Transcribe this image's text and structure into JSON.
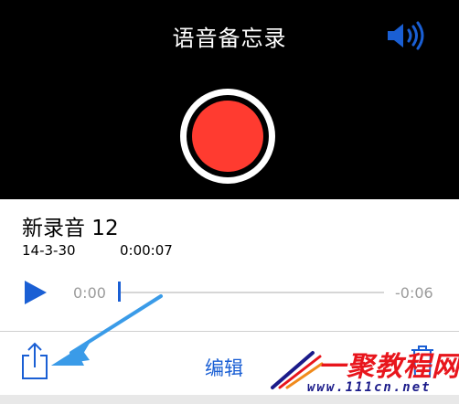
{
  "header": {
    "title": "语音备忘录",
    "speaker_icon": "speaker-volume-icon"
  },
  "record_button": {
    "icon": "record-icon",
    "color": "#ff3b30"
  },
  "recording": {
    "name": "新录音 12",
    "date": "14-3-30",
    "duration": "0:00:07"
  },
  "player": {
    "play_icon": "play-icon",
    "elapsed": "0:00",
    "remaining": "-0:06",
    "progress": 0
  },
  "toolbar": {
    "share_icon": "share-icon",
    "edit_label": "编辑",
    "trash_icon": "trash-icon"
  },
  "watermark": {
    "text": "一聚教程网",
    "url": "www.111cn.net"
  },
  "colors": {
    "accent": "#1a5fd4",
    "record": "#ff3b30",
    "annotation_arrow": "#3a9be8"
  }
}
